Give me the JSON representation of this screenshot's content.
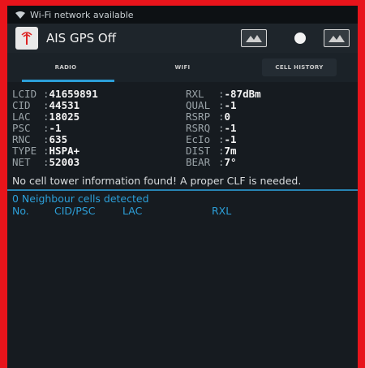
{
  "status_bar": {
    "text": "Wi-Fi network available"
  },
  "action_bar": {
    "title": "AIS GPS Off"
  },
  "tabs": [
    {
      "label": "RADIO"
    },
    {
      "label": "WIFI"
    },
    {
      "label": "CELL HISTORY"
    }
  ],
  "cell_info": {
    "left": [
      {
        "label": "LCID",
        "value": "41659891"
      },
      {
        "label": "CID",
        "value": "44531"
      },
      {
        "label": "LAC",
        "value": "18025"
      },
      {
        "label": "PSC",
        "value": "-1"
      },
      {
        "label": "RNC",
        "value": "635"
      },
      {
        "label": "TYPE",
        "value": "HSPA+"
      },
      {
        "label": "NET",
        "value": "52003"
      }
    ],
    "right": [
      {
        "label": "RXL",
        "value": "-87dBm"
      },
      {
        "label": "QUAL",
        "value": "-1"
      },
      {
        "label": "RSRP",
        "value": "0"
      },
      {
        "label": "RSRQ",
        "value": "-1"
      },
      {
        "label": "EcIo",
        "value": "-1"
      },
      {
        "label": "DIST",
        "value": "7m"
      },
      {
        "label": "BEAR",
        "value": "7°"
      }
    ]
  },
  "notice": "No cell tower information found! A proper CLF is needed.",
  "neighbours": {
    "summary": "0 Neighbour cells detected",
    "columns": [
      "No.",
      "CID/PSC",
      "LAC",
      "RXL"
    ]
  }
}
